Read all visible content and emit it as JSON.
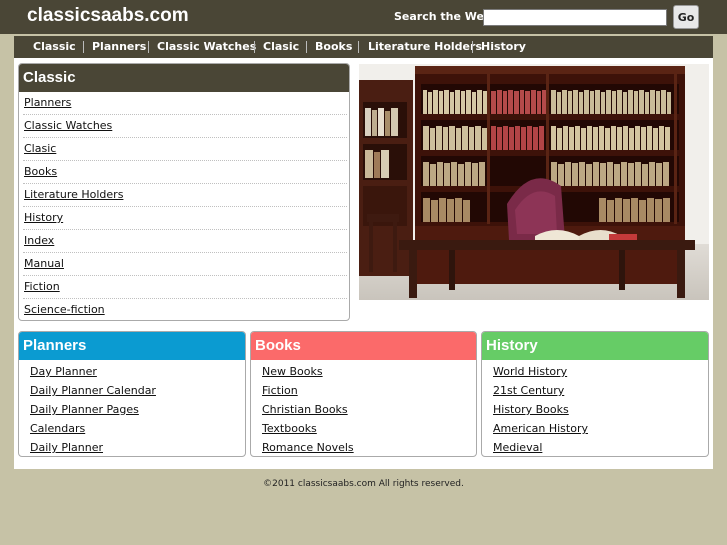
{
  "header": {
    "site_title": "classicsaabs.com",
    "search_label": "Search the Web:",
    "search_value": "",
    "go_label": "Go"
  },
  "nav": {
    "items": [
      "Classic",
      "Planners",
      "Classic Watches",
      "Clasic",
      "Books",
      "Literature Holders",
      "History"
    ]
  },
  "classic_box": {
    "title": "Classic",
    "links": [
      "Planners",
      "Classic Watches",
      "Clasic",
      "Books",
      "Literature Holders",
      "History",
      "Index",
      "Manual",
      "Fiction",
      "Science-fiction"
    ]
  },
  "planners_box": {
    "title": "Planners",
    "links": [
      "Day Planner",
      "Daily Planner Calendar",
      "Daily Planner Pages",
      "Calendars",
      "Daily Planner"
    ]
  },
  "books_box": {
    "title": "Books",
    "links": [
      "New Books",
      "Fiction",
      "Christian Books",
      "Textbooks",
      "Romance Novels"
    ]
  },
  "history_box": {
    "title": "History",
    "links": [
      "World History",
      "21st Century",
      "History Books",
      "American History",
      "Medieval"
    ]
  },
  "footer": {
    "text": "©2011 classicsaabs.com All rights reserved."
  },
  "colors": {
    "header_bg": "#4a4636",
    "page_bg": "#c6c2a6",
    "planners_head": "#0b9bd1",
    "books_head": "#fb6a6a",
    "history_head": "#66cc66"
  }
}
